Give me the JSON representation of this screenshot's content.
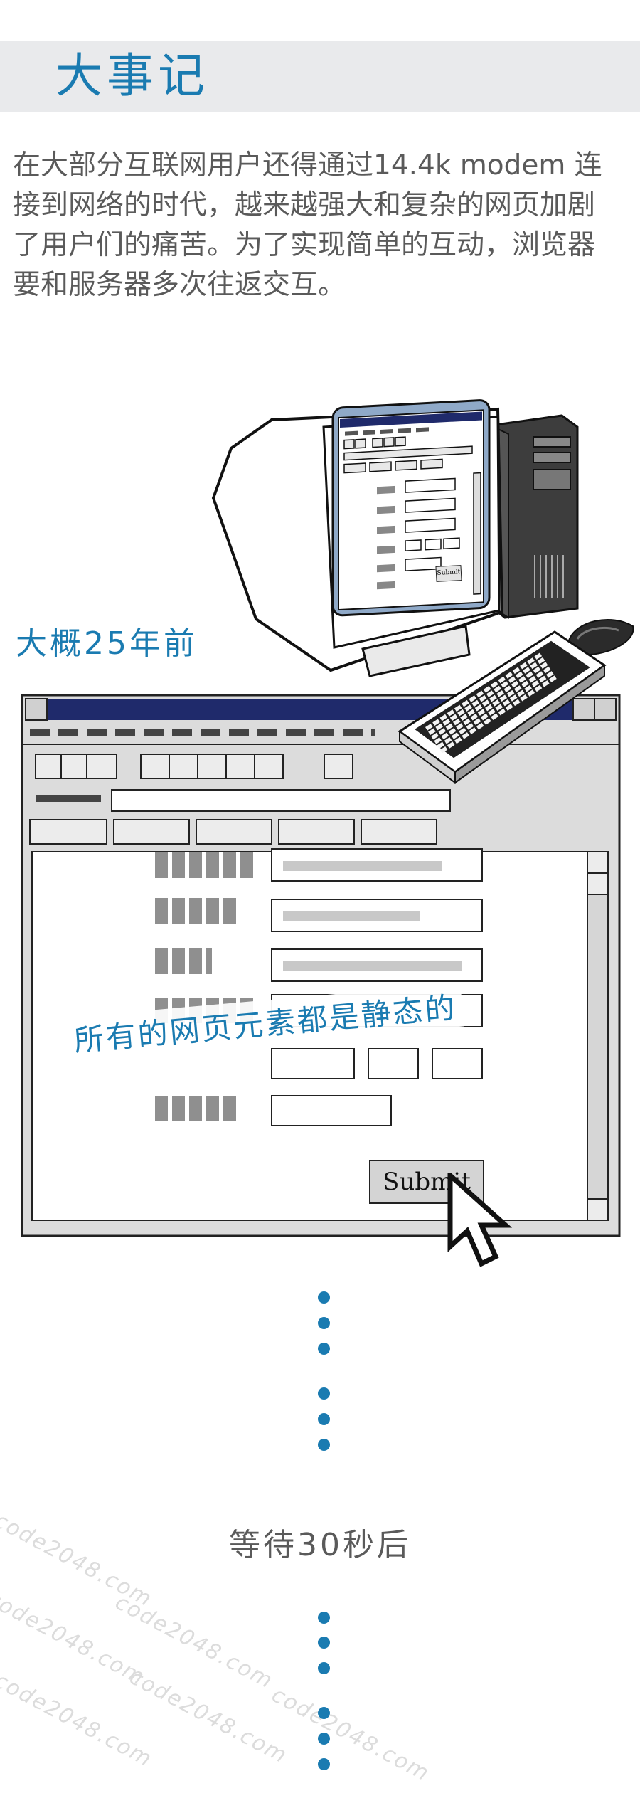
{
  "header": {
    "title": "大事记"
  },
  "intro": {
    "text": "在大部分互联网用户还得通过14.4k modem 连接到网络的时代，越来越强大和复杂的网页加剧了用户们的痛苦。为了实现简单的互动，浏览器要和服务器多次往返交互。"
  },
  "illustration": {
    "era_label": "大概25年前",
    "monitor_submit_label": "Submit",
    "form_submit_label": "Submit",
    "static_caption": "所有的网页元素都是静态的"
  },
  "timeline": {
    "wait_label": "等待30秒后"
  },
  "watermark": {
    "text": "code2048.com"
  },
  "colors": {
    "accent": "#1a7bb1",
    "text": "#5a5a5a",
    "band": "#e9eaec",
    "window_title_bar": "#1f2a6b"
  }
}
